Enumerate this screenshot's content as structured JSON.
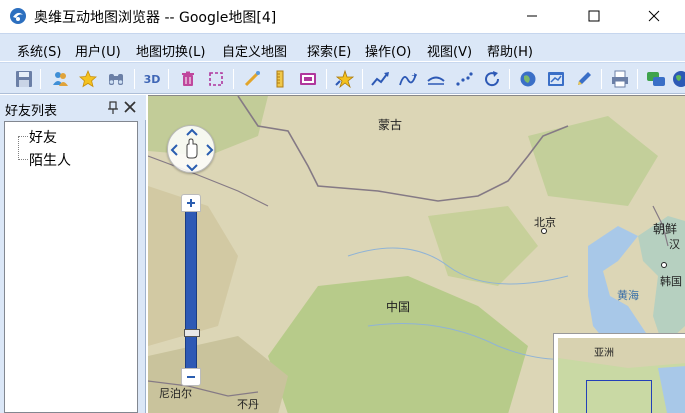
{
  "window": {
    "title": "奥维互动地图浏览器 -- Google地图[4]",
    "minimize_icon": "minimize-icon",
    "maximize_icon": "maximize-icon",
    "close_icon": "close-icon"
  },
  "menu": {
    "items": [
      {
        "label": "系统(S)"
      },
      {
        "label": "用户(U)"
      },
      {
        "label": "地图切换(L)"
      },
      {
        "label": "自定义地图"
      },
      {
        "label": "探索(E)"
      },
      {
        "label": "操作(O)"
      },
      {
        "label": "视图(V)"
      },
      {
        "label": "帮助(H)"
      }
    ]
  },
  "toolbar": {
    "three_d_label": "3D",
    "icons": [
      "save-icon",
      "users-icon",
      "favorite-star-icon",
      "binoculars-icon",
      "3d-icon",
      "delete-icon",
      "select-rect-icon",
      "measure-pen-icon",
      "ruler-icon",
      "screen-icon",
      "add-star-icon",
      "route-icon",
      "curve-icon",
      "road-icon",
      "points-icon",
      "rotate-icon",
      "globe-icon",
      "map-edit-icon",
      "pencil-icon",
      "print-icon",
      "chat-icon",
      "earth-icon"
    ]
  },
  "left_panel": {
    "title": "好友列表",
    "tree": [
      {
        "label": "好友"
      },
      {
        "label": "陌生人"
      }
    ]
  },
  "map": {
    "labels": {
      "mongolia": "蒙古",
      "beijing": "北京",
      "china": "中国",
      "korea_north": "朝鲜",
      "korea_south": "韩国",
      "korea_partial": "汉",
      "yellow_sea": "黄海",
      "nepal": "尼泊尔",
      "bhutan": "不丹",
      "asia": "亚洲"
    },
    "colors": {
      "land": "#d9d4b3",
      "water": "#a8c8e8",
      "green": "#b9cc8f",
      "border": "#7a6f7a",
      "zoom_bar": "#2d59b5"
    }
  }
}
